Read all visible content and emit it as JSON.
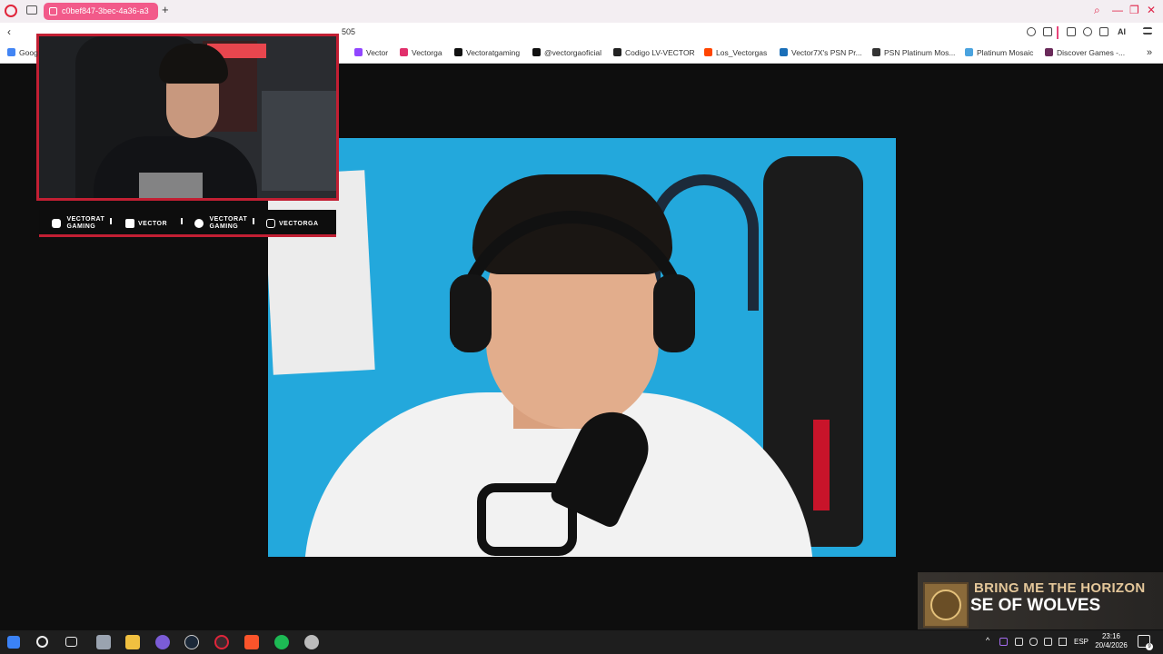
{
  "browser": {
    "active_tab_title": "c0bef847-3bec-4a36-a3",
    "new_tab_symbol": "+",
    "url_fragment": "505",
    "ai_label": "AI",
    "back_symbol": "‹",
    "more_symbol": "»"
  },
  "bookmarks": [
    {
      "label": "Goog",
      "color": "#4285f4"
    },
    {
      "label": "Vector",
      "color": "#9146ff"
    },
    {
      "label": "Vectorga",
      "color": "#e1306c"
    },
    {
      "label": "Vectoratgaming",
      "color": "#111111"
    },
    {
      "label": "@vectorgaoficial",
      "color": "#111111"
    },
    {
      "label": "Codigo LV-VECTOR",
      "color": "#222222"
    },
    {
      "label": "Los_Vectorgas",
      "color": "#ff4500"
    },
    {
      "label": "Vector7X's PSN Pr...",
      "color": "#1a6fb8"
    },
    {
      "label": "PSN Platinum Mos...",
      "color": "#333333"
    },
    {
      "label": "Platinum Mosaic",
      "color": "#4aa3df"
    },
    {
      "label": "Discover Games -...",
      "color": "#6a2a5a"
    }
  ],
  "overlay": {
    "socials": [
      {
        "label": "VECTORAT\nGAMING",
        "line1": "VECTORAT",
        "line2": "GAMING",
        "icon": "youtube-icon"
      },
      {
        "label": "VECTOR",
        "line1": "VECTOR",
        "line2": "",
        "icon": "twitch-icon"
      },
      {
        "label": "VECTORAT\nGAMING",
        "line1": "VECTORAT",
        "line2": "GAMING",
        "icon": "twitter-icon"
      },
      {
        "label": "VECTORGA",
        "line1": "VECTORGA",
        "line2": "",
        "icon": "instagram-icon"
      }
    ],
    "accent": "#c21f33"
  },
  "now_playing": {
    "artist": "BRING ME THE HORIZON",
    "title": "SE OF WOLVES"
  },
  "taskbar": {
    "lang": "ESP",
    "time": "23:16",
    "date": "20/4/2026",
    "notif_count": "9"
  }
}
